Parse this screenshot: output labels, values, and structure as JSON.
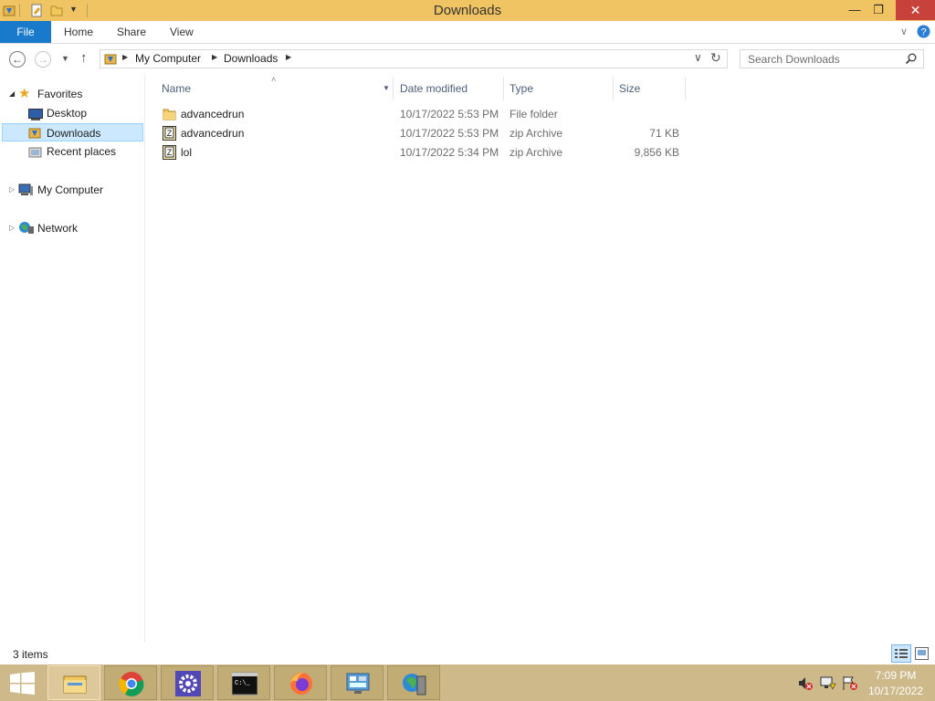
{
  "window": {
    "title": "Downloads",
    "buttons": {
      "minimize": "—",
      "restore": "❐",
      "close": "✕"
    }
  },
  "ribbon": {
    "tabs": [
      {
        "label": "File"
      },
      {
        "label": "Home"
      },
      {
        "label": "Share"
      },
      {
        "label": "View"
      }
    ],
    "expand_icon": "chevron-down-icon",
    "help_icon": "help-icon"
  },
  "address": {
    "crumbs": [
      "My Computer",
      "Downloads"
    ],
    "search_placeholder": "Search Downloads"
  },
  "nav": {
    "favorites": "Favorites",
    "desktop": "Desktop",
    "downloads": "Downloads",
    "recent": "Recent places",
    "computer": "My Computer",
    "network": "Network"
  },
  "columns": {
    "name": "Name",
    "date": "Date modified",
    "type": "Type",
    "size": "Size"
  },
  "files": [
    {
      "name": "advancedrun",
      "date": "10/17/2022 5:53 PM",
      "type": "File folder",
      "size": "",
      "icon": "folder-icon"
    },
    {
      "name": "advancedrun",
      "date": "10/17/2022 5:53 PM",
      "type": "zip Archive",
      "size": "71 KB",
      "icon": "zip-icon"
    },
    {
      "name": "lol",
      "date": "10/17/2022 5:34 PM",
      "type": "zip Archive",
      "size": "9,856 KB",
      "icon": "zip-icon"
    }
  ],
  "status": {
    "count": "3 items"
  },
  "taskbar": {
    "time": "7:09 PM",
    "date": "10/17/2022",
    "apps": [
      "file-explorer-icon",
      "chrome-icon",
      "settings-gear-icon",
      "cmd-icon",
      "firefox-icon",
      "control-panel-icon",
      "network-tool-icon"
    ]
  },
  "colors": {
    "titlebar": "#f0c463",
    "file_tab": "#1979ca",
    "selection": "#cce8ff",
    "taskbar": "#cdb98a",
    "close": "#c7423b"
  }
}
